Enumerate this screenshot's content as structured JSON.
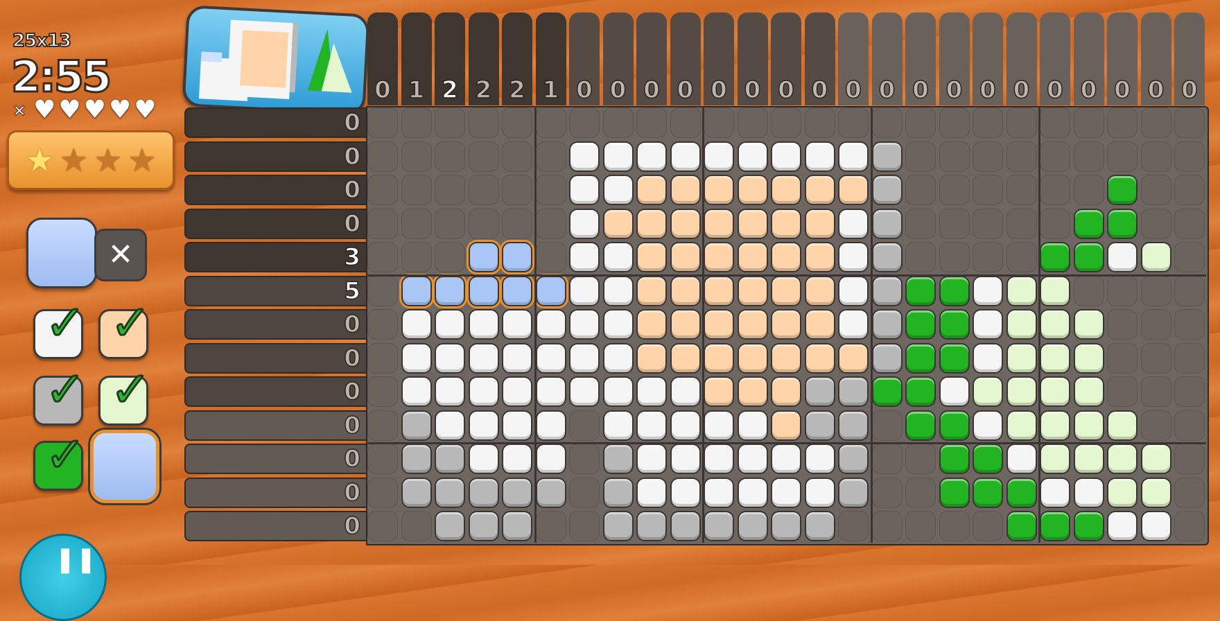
{
  "hud": {
    "size_label": "25x13",
    "timer": "2:55",
    "lives_prefix": "×",
    "hearts": 5,
    "stars_earned": 1,
    "stars_total": 4
  },
  "colors": {
    "W": "#f5f5f5",
    "P": "#ffd4a8",
    "G": "#b8b8b8",
    "D": "#22b422",
    "L": "#e4f7cf",
    "B": "#a9c6f5",
    "accent": "#e8922d"
  },
  "palette": [
    {
      "name": "white",
      "color": "#f5f5f5",
      "done": true
    },
    {
      "name": "peach",
      "color": "#ffd4a8",
      "done": true
    },
    {
      "name": "grey",
      "color": "#b8b8b8",
      "done": true
    },
    {
      "name": "pale-green",
      "color": "#e4f7cf",
      "done": true
    },
    {
      "name": "green",
      "color": "#22b422",
      "done": true
    },
    {
      "name": "blue",
      "color": "#a9c6f5",
      "done": false,
      "selected": true
    }
  ],
  "puzzle": {
    "col_clues": [
      "0",
      "1",
      "2",
      "2",
      "2",
      "1",
      "0",
      "0",
      "0",
      "0",
      "0",
      "0",
      "0",
      "0",
      "0",
      "0",
      "0",
      "0",
      "0",
      "0",
      "0",
      "0",
      "0",
      "0",
      "0"
    ],
    "col_highlight": 2,
    "row_clues": [
      "0",
      "0",
      "0",
      "0",
      "3",
      "5",
      "0",
      "0",
      "0",
      "0",
      "0",
      "0",
      "0"
    ],
    "row_highlight": [
      4,
      5
    ],
    "rows": [
      ".........................",
      "......WWWWWWWWWG.........",
      "......WWPPPPPPPG......D..",
      "......WPPPPPPPWG.....DD..",
      "...BB.WWPPPPPPWG....DDWL.",
      ".BBBBBWWPPPPPPWGDDWLL....",
      ".WWWWWWWPPPPPPWGDDWLLL...",
      ".WWWWWWWPPPPPPPGDDWLLL...",
      ".WWWWWWWWWPPPGGDDWLLLL...",
      ".GWWWW.WWWWWPGG.DDWLLLL..",
      ".GGWWW.GWWWWWWG..DDWLLLL.",
      ".GGGGG.GWWWWWWG..DDDWWLL.",
      "..GGG..GGGGGGG.....DDDWW."
    ]
  }
}
